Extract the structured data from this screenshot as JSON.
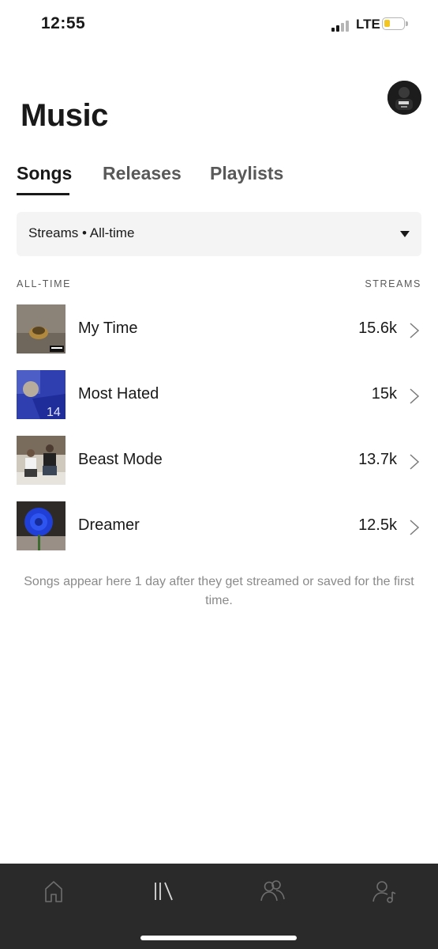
{
  "status_bar": {
    "time": "12:55",
    "network": "LTE",
    "battery_level": 0.3,
    "battery_color": "#f3c623",
    "signal_bars": 2
  },
  "header": {
    "title": "Music",
    "avatar": "profile-avatar"
  },
  "tabs": [
    {
      "label": "Songs",
      "active": true
    },
    {
      "label": "Releases",
      "active": false
    },
    {
      "label": "Playlists",
      "active": false
    }
  ],
  "filter": {
    "label": "Streams • All-time",
    "icon": "chevron-down-icon"
  },
  "list_header": {
    "left": "ALL-TIME",
    "right": "STREAMS"
  },
  "songs": [
    {
      "title": "My Time",
      "streams": "15.6k",
      "art": "ring-cover"
    },
    {
      "title": "Most Hated",
      "streams": "15k",
      "art": "dodgers-cover"
    },
    {
      "title": "Beast Mode",
      "streams": "13.7k",
      "art": "duo-photo-cover"
    },
    {
      "title": "Dreamer",
      "streams": "12.5k",
      "art": "blue-rose-cover"
    }
  ],
  "footnote": "Songs appear here 1 day after they get streamed or saved for the first time.",
  "bottom_nav": [
    {
      "icon": "home-icon",
      "active": false
    },
    {
      "icon": "library-icon",
      "active": true
    },
    {
      "icon": "audience-icon",
      "active": false
    },
    {
      "icon": "profile-music-icon",
      "active": false
    }
  ],
  "colors": {
    "text": "#191919",
    "muted": "#595959",
    "nav_background": "#2a2a2a",
    "filter_background": "#f4f4f4"
  }
}
